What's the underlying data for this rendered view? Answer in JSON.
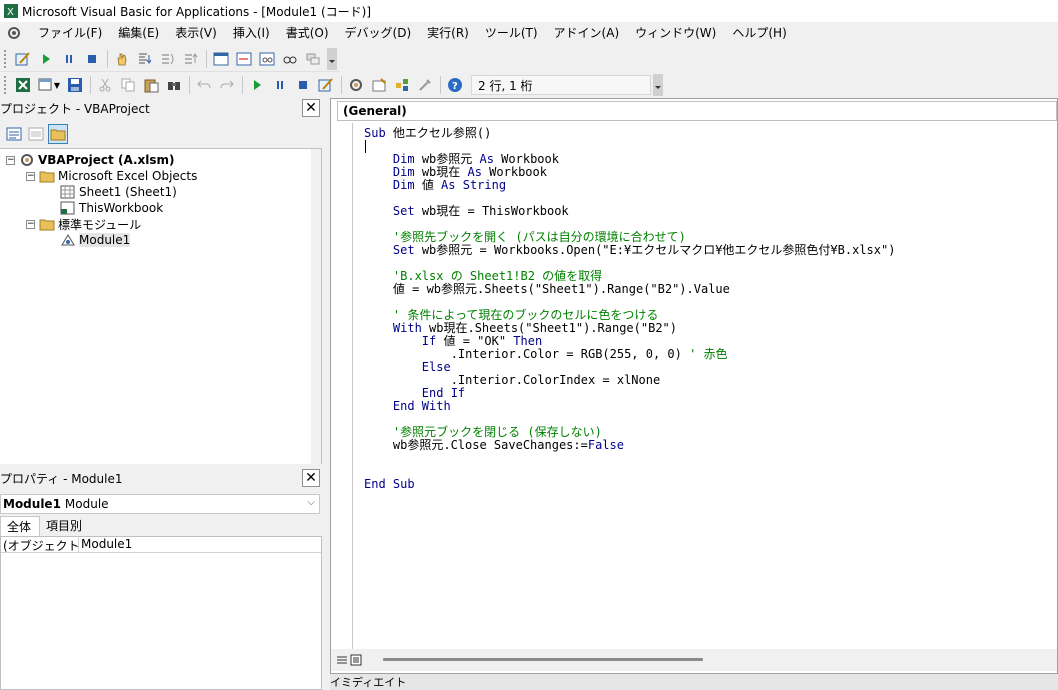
{
  "window": {
    "title": "Microsoft Visual Basic for Applications - [Module1 (コード)]"
  },
  "menu": [
    "ファイル(F)",
    "編集(E)",
    "表示(V)",
    "挿入(I)",
    "書式(O)",
    "デバッグ(D)",
    "実行(R)",
    "ツール(T)",
    "アドイン(A)",
    "ウィンドウ(W)",
    "ヘルプ(H)"
  ],
  "toolbar": {
    "cursor_position": "2 行, 1 桁"
  },
  "project": {
    "title": "プロジェクト - VBAProject",
    "tree": [
      {
        "label": "VBAProject (A.xlsm)",
        "bold": true
      },
      {
        "label": "Microsoft Excel Objects",
        "bold": false
      },
      {
        "label": "Sheet1 (Sheet1)",
        "bold": false
      },
      {
        "label": "ThisWorkbook",
        "bold": false
      },
      {
        "label": "標準モジュール",
        "bold": false
      },
      {
        "label": "Module1",
        "bold": false
      }
    ]
  },
  "properties": {
    "title": "プロパティ - Module1",
    "object_name": "Module1",
    "object_type": "Module",
    "tabs": [
      "全体",
      "項目別"
    ],
    "rows": [
      {
        "name": "(オブジェクト名)",
        "value": "Module1"
      }
    ]
  },
  "code": {
    "combo": "(General)",
    "lines": [
      [
        [
          "kw",
          "Sub"
        ],
        [
          "t",
          " 他エクセル参照()"
        ]
      ],
      [
        [
          "t",
          ""
        ]
      ],
      [
        [
          "t",
          "    "
        ],
        [
          "kw",
          "Dim"
        ],
        [
          "t",
          " wb参照元 "
        ],
        [
          "kw",
          "As"
        ],
        [
          "t",
          " Workbook"
        ]
      ],
      [
        [
          "t",
          "    "
        ],
        [
          "kw",
          "Dim"
        ],
        [
          "t",
          " wb現在 "
        ],
        [
          "kw",
          "As"
        ],
        [
          "t",
          " Workbook"
        ]
      ],
      [
        [
          "t",
          "    "
        ],
        [
          "kw",
          "Dim"
        ],
        [
          "t",
          " 値 "
        ],
        [
          "kw",
          "As"
        ],
        [
          "t",
          " "
        ],
        [
          "kw",
          "String"
        ]
      ],
      [
        [
          "t",
          ""
        ]
      ],
      [
        [
          "t",
          "    "
        ],
        [
          "kw",
          "Set"
        ],
        [
          "t",
          " wb現在 = ThisWorkbook"
        ]
      ],
      [
        [
          "t",
          ""
        ]
      ],
      [
        [
          "t",
          "    "
        ],
        [
          "cm",
          "'参照先ブックを開く (パスは自分の環境に合わせて)"
        ]
      ],
      [
        [
          "t",
          "    "
        ],
        [
          "kw",
          "Set"
        ],
        [
          "t",
          " wb参照元 = Workbooks.Open(\"E:¥エクセルマクロ¥他エクセル参照色付¥B.xlsx\")"
        ]
      ],
      [
        [
          "t",
          ""
        ]
      ],
      [
        [
          "t",
          "    "
        ],
        [
          "cm",
          "'B.xlsx の Sheet1!B2 の値を取得"
        ]
      ],
      [
        [
          "t",
          "    値 = wb参照元.Sheets(\"Sheet1\").Range(\"B2\").Value"
        ]
      ],
      [
        [
          "t",
          ""
        ]
      ],
      [
        [
          "t",
          "    "
        ],
        [
          "cm",
          "' 条件によって現在のブックのセルに色をつける"
        ]
      ],
      [
        [
          "t",
          "    "
        ],
        [
          "kw",
          "With"
        ],
        [
          "t",
          " wb現在.Sheets(\"Sheet1\").Range(\"B2\")"
        ]
      ],
      [
        [
          "t",
          "        "
        ],
        [
          "kw",
          "If"
        ],
        [
          "t",
          " 値 = \"OK\" "
        ],
        [
          "kw",
          "Then"
        ]
      ],
      [
        [
          "t",
          "            .Interior.Color = RGB(255, 0, 0) "
        ],
        [
          "cm",
          "' 赤色"
        ]
      ],
      [
        [
          "t",
          "        "
        ],
        [
          "kw",
          "Else"
        ]
      ],
      [
        [
          "t",
          "            .Interior.ColorIndex = xlNone"
        ]
      ],
      [
        [
          "t",
          "        "
        ],
        [
          "kw",
          "End If"
        ]
      ],
      [
        [
          "t",
          "    "
        ],
        [
          "kw",
          "End With"
        ]
      ],
      [
        [
          "t",
          ""
        ]
      ],
      [
        [
          "t",
          "    "
        ],
        [
          "cm",
          "'参照元ブックを閉じる (保存しない)"
        ]
      ],
      [
        [
          "t",
          "    wb参照元.Close SaveChanges:="
        ],
        [
          "kw",
          "False"
        ]
      ],
      [
        [
          "t",
          ""
        ]
      ],
      [
        [
          "t",
          ""
        ]
      ],
      [
        [
          "kw",
          "End Sub"
        ]
      ]
    ]
  },
  "immediate": {
    "title": "イミディエイト"
  },
  "colors": {
    "keyword": "#00008b",
    "comment": "#008000"
  }
}
